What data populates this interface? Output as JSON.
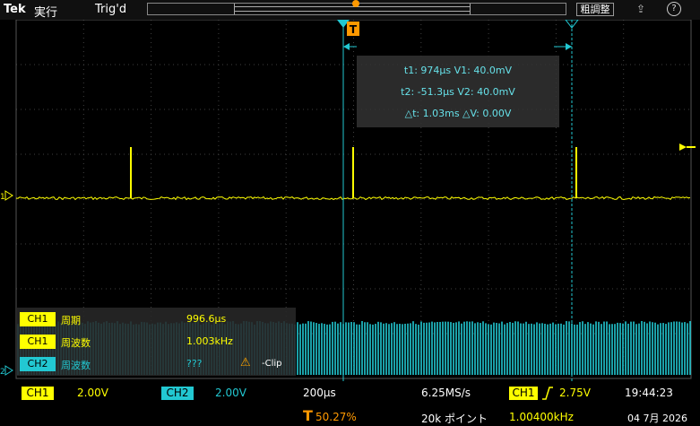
{
  "topbar": {
    "logo": "Tek",
    "run_state": "実行",
    "trigger_state": "Trig'd",
    "coarse_label": "粗調整",
    "help": "?"
  },
  "colors": {
    "ch1": "#ffff00",
    "ch2": "#22c8d2",
    "cursor": "#22c8d2",
    "trigger": "#ff9900",
    "background": "#000000",
    "grid": "#404040"
  },
  "markers": {
    "ch1_marker": "1",
    "ch2_marker": "2",
    "cursor_a": "a",
    "cursor_b": "b",
    "trigger_pos": "T"
  },
  "cursor_readout": {
    "line1": "t1: 974µs  V1: 40.0mV",
    "line2": "t2: -51.3µs  V2: 40.0mV",
    "line3": "△t: 1.03ms  △V: 0.00V"
  },
  "measurements": [
    {
      "badge": "CH1",
      "name": "周期",
      "value": "996.6µs",
      "color": "#ffff00"
    },
    {
      "badge": "CH1",
      "name": "周波数",
      "value": "1.003kHz",
      "color": "#ffff00"
    },
    {
      "badge": "CH2",
      "name": "周波数",
      "value": "???",
      "color": "#22c8d2",
      "warn_icon": "warning-icon",
      "warn_text": "-Clip"
    }
  ],
  "bottombar": {
    "ch1_badge": "CH1",
    "ch1_scale": "2.00V",
    "ch2_badge": "CH2",
    "ch2_scale": "2.00V",
    "timebase": "200µs",
    "trigger_position_icon": "T",
    "trigger_position": "50.27%",
    "sample_rate": "6.25MS/s",
    "record_length": "20k ポイント",
    "trigger_source_badge": "CH1",
    "trigger_slope_icon": "rising-edge-icon",
    "trigger_level": "2.75V",
    "trigger_frequency": "1.00400kHz",
    "time": "19:44:23",
    "date": "04 7月 2026"
  }
}
